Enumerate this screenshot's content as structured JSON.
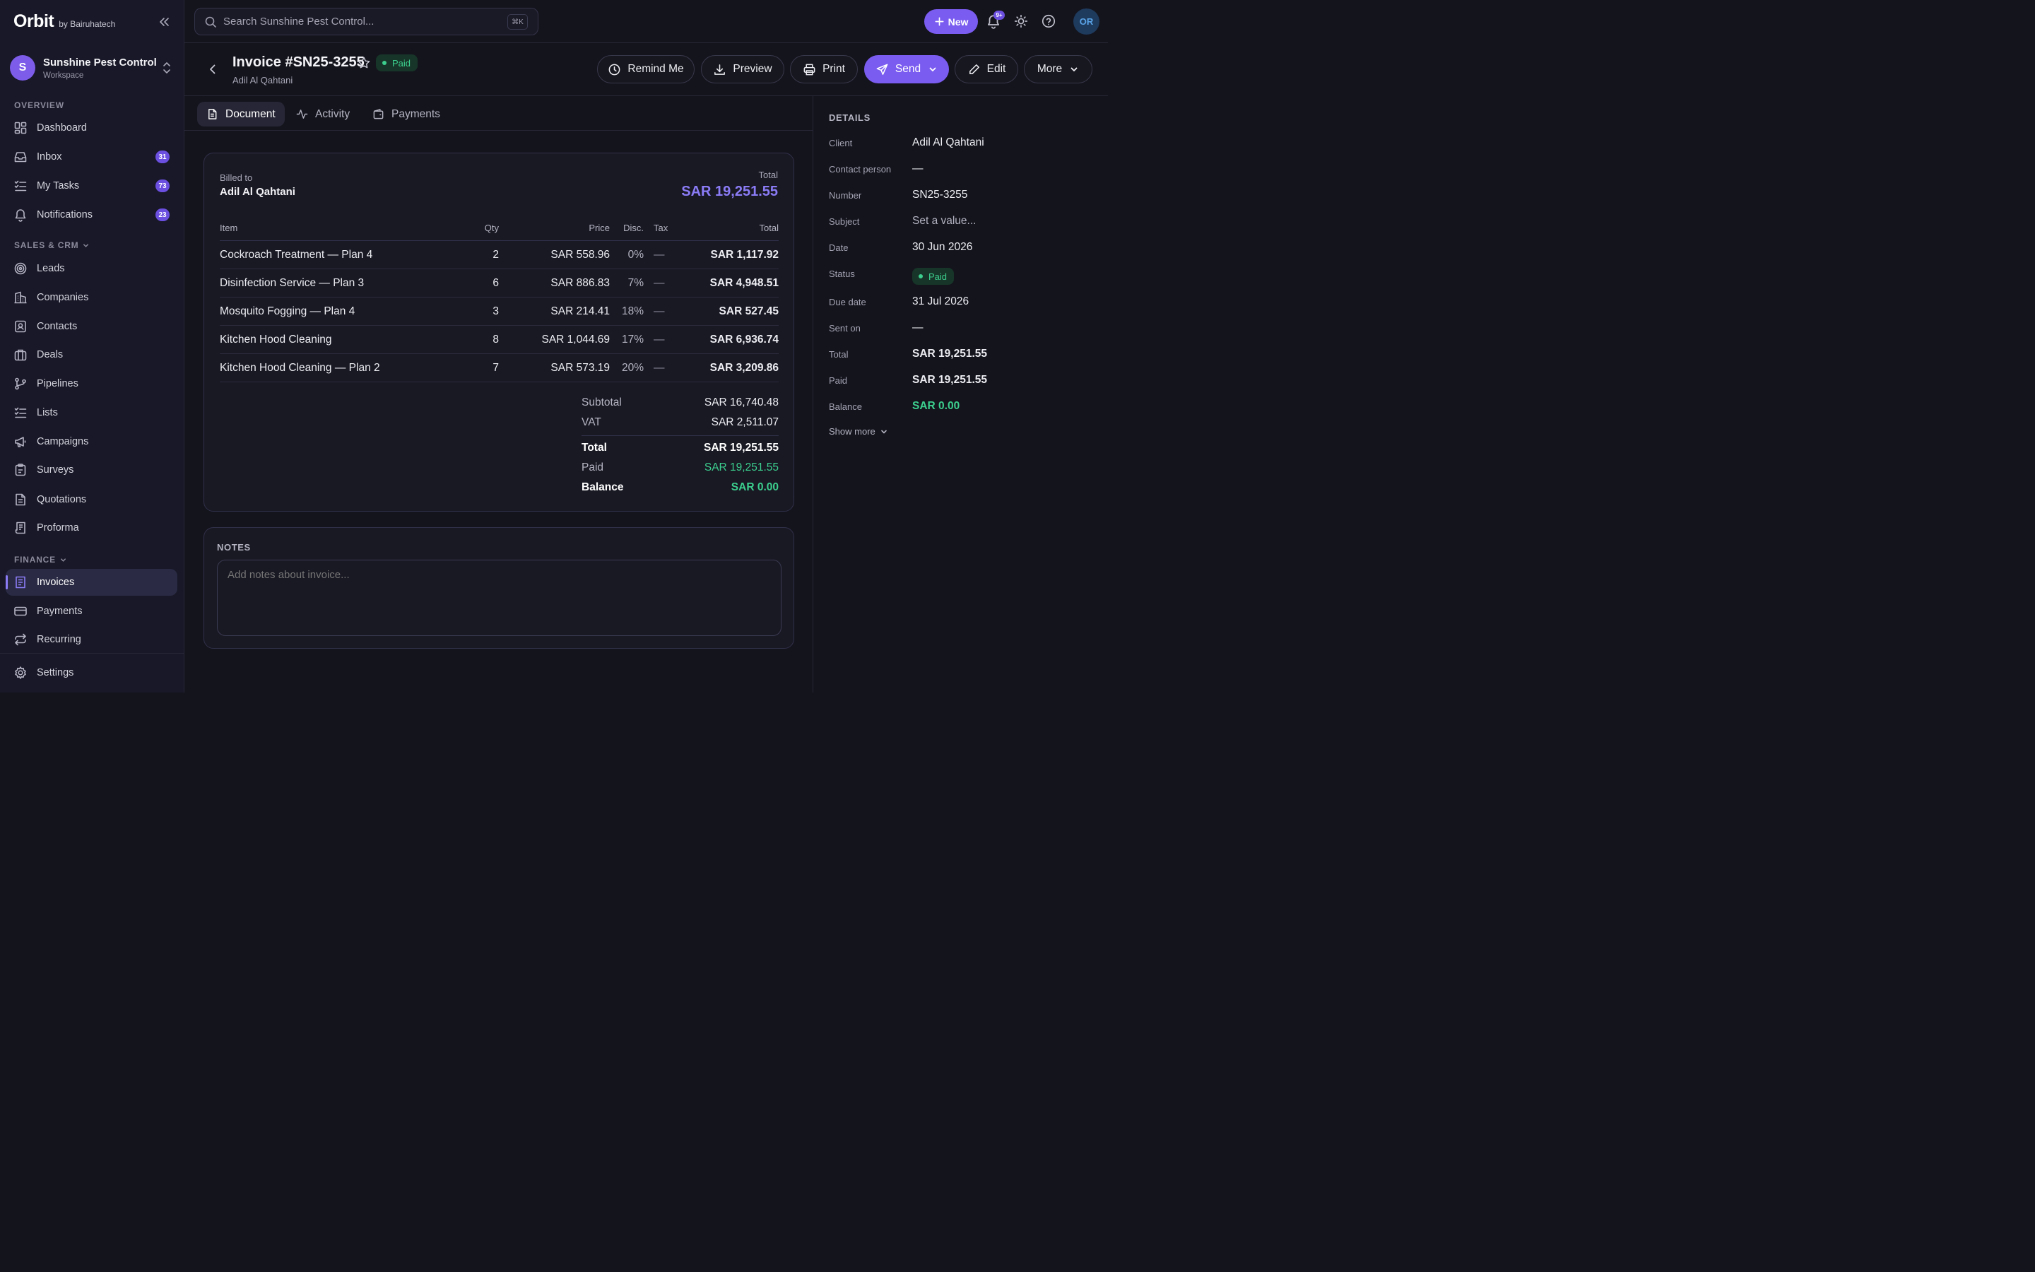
{
  "brand": {
    "logo": "Orbit",
    "by": "by Bairuhatech"
  },
  "workspace": {
    "initial": "S",
    "name": "Sunshine Pest Control",
    "sub": "Workspace"
  },
  "sidebar": {
    "overview_label": "OVERVIEW",
    "sales_label": "SALES & CRM",
    "finance_label": "FINANCE",
    "items": {
      "dashboard": {
        "label": "Dashboard",
        "icon": "dashboard-icon"
      },
      "inbox": {
        "label": "Inbox",
        "badge": "31",
        "icon": "inbox-icon"
      },
      "tasks": {
        "label": "My Tasks",
        "badge": "73",
        "icon": "tasks-icon"
      },
      "notifications": {
        "label": "Notifications",
        "badge": "23",
        "icon": "bell-icon"
      },
      "leads": {
        "label": "Leads",
        "icon": "target-icon"
      },
      "companies": {
        "label": "Companies",
        "icon": "building-icon"
      },
      "contacts": {
        "label": "Contacts",
        "icon": "contact-icon"
      },
      "deals": {
        "label": "Deals",
        "icon": "briefcase-icon"
      },
      "pipelines": {
        "label": "Pipelines",
        "icon": "pipeline-icon"
      },
      "lists": {
        "label": "Lists",
        "icon": "list-icon"
      },
      "campaigns": {
        "label": "Campaigns",
        "icon": "megaphone-icon"
      },
      "surveys": {
        "label": "Surveys",
        "icon": "clipboard-icon"
      },
      "quotations": {
        "label": "Quotations",
        "icon": "document-icon"
      },
      "proforma": {
        "label": "Proforma",
        "icon": "receipt-icon"
      },
      "invoices": {
        "label": "Invoices",
        "icon": "invoice-icon"
      },
      "payments": {
        "label": "Payments",
        "icon": "card-icon"
      },
      "recurring": {
        "label": "Recurring",
        "icon": "repeat-icon"
      },
      "settings": {
        "label": "Settings",
        "icon": "gear-icon"
      }
    }
  },
  "topbar": {
    "search_placeholder": "Search Sunshine Pest Control...",
    "shortcut": "⌘K",
    "new_label": "New",
    "notif_badge": "9+",
    "user_initials": "OR"
  },
  "header": {
    "title": "Invoice #SN25-3255",
    "status": "Paid",
    "client": "Adil Al Qahtani",
    "buttons": {
      "remind": "Remind Me",
      "preview": "Preview",
      "print": "Print",
      "send": "Send",
      "edit": "Edit",
      "more": "More"
    }
  },
  "tabs": {
    "document": "Document",
    "activity": "Activity",
    "payments": "Payments"
  },
  "invoice": {
    "billed_to_label": "Billed to",
    "billed_to": "Adil Al Qahtani",
    "total_label": "Total",
    "total": "SAR 19,251.55",
    "columns": {
      "item": "Item",
      "qty": "Qty",
      "price": "Price",
      "disc": "Disc.",
      "tax": "Tax",
      "total": "Total"
    },
    "rows": [
      {
        "item": "Cockroach Treatment — Plan 4",
        "qty": "2",
        "price": "SAR 558.96",
        "disc": "0%",
        "tax": "—",
        "total": "SAR 1,117.92"
      },
      {
        "item": "Disinfection Service — Plan 3",
        "qty": "6",
        "price": "SAR 886.83",
        "disc": "7%",
        "tax": "—",
        "total": "SAR 4,948.51"
      },
      {
        "item": "Mosquito Fogging — Plan 4",
        "qty": "3",
        "price": "SAR 214.41",
        "disc": "18%",
        "tax": "—",
        "total": "SAR 527.45"
      },
      {
        "item": "Kitchen Hood Cleaning",
        "qty": "8",
        "price": "SAR 1,044.69",
        "disc": "17%",
        "tax": "—",
        "total": "SAR 6,936.74"
      },
      {
        "item": "Kitchen Hood Cleaning — Plan 2",
        "qty": "7",
        "price": "SAR 573.19",
        "disc": "20%",
        "tax": "—",
        "total": "SAR 3,209.86"
      }
    ],
    "summary": {
      "subtotal_label": "Subtotal",
      "subtotal": "SAR 16,740.48",
      "vat_label": "VAT",
      "vat": "SAR 2,511.07",
      "total_label": "Total",
      "total": "SAR 19,251.55",
      "paid_label": "Paid",
      "paid": "SAR 19,251.55",
      "balance_label": "Balance",
      "balance": "SAR 0.00"
    }
  },
  "notes": {
    "label": "NOTES",
    "placeholder": "Add notes about invoice..."
  },
  "details": {
    "title": "DETAILS",
    "client_label": "Client",
    "client": "Adil Al Qahtani",
    "contact_label": "Contact person",
    "contact": "—",
    "number_label": "Number",
    "number": "SN25-3255",
    "subject_label": "Subject",
    "subject": "Set a value...",
    "date_label": "Date",
    "date": "30 Jun 2026",
    "status_label": "Status",
    "status": "Paid",
    "due_label": "Due date",
    "due": "31 Jul 2026",
    "sent_label": "Sent on",
    "sent": "—",
    "total_label": "Total",
    "total": "SAR 19,251.55",
    "paid_label": "Paid",
    "paid": "SAR 19,251.55",
    "balance_label": "Balance",
    "balance": "SAR 0.00",
    "show_more": "Show more"
  },
  "colors": {
    "accent": "#7b5cf0",
    "success": "#3ccf8e",
    "background": "#14141d"
  }
}
